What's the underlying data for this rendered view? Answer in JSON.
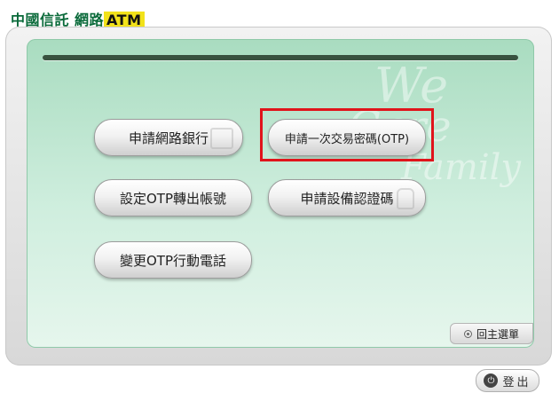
{
  "header": {
    "brand": "中國信託",
    "service_prefix": "網路",
    "service_suffix": "ATM"
  },
  "menu": {
    "items": [
      {
        "label": "申請網路銀行"
      },
      {
        "label": "申請一次交易密碼(OTP)"
      },
      {
        "label": "設定OTP轉出帳號"
      },
      {
        "label": "申請設備認證碼"
      },
      {
        "label": "變更OTP行動電話"
      }
    ]
  },
  "watermark": [
    "We",
    "Care",
    "Family"
  ],
  "footer": {
    "back_label": "回主選單",
    "logout_label": "登出"
  },
  "colors": {
    "brand_green": "#0a6a3a",
    "panel_green": "#a9dcc0",
    "highlight_red": "#e0141b",
    "atm_yellow": "#f2e21a"
  }
}
